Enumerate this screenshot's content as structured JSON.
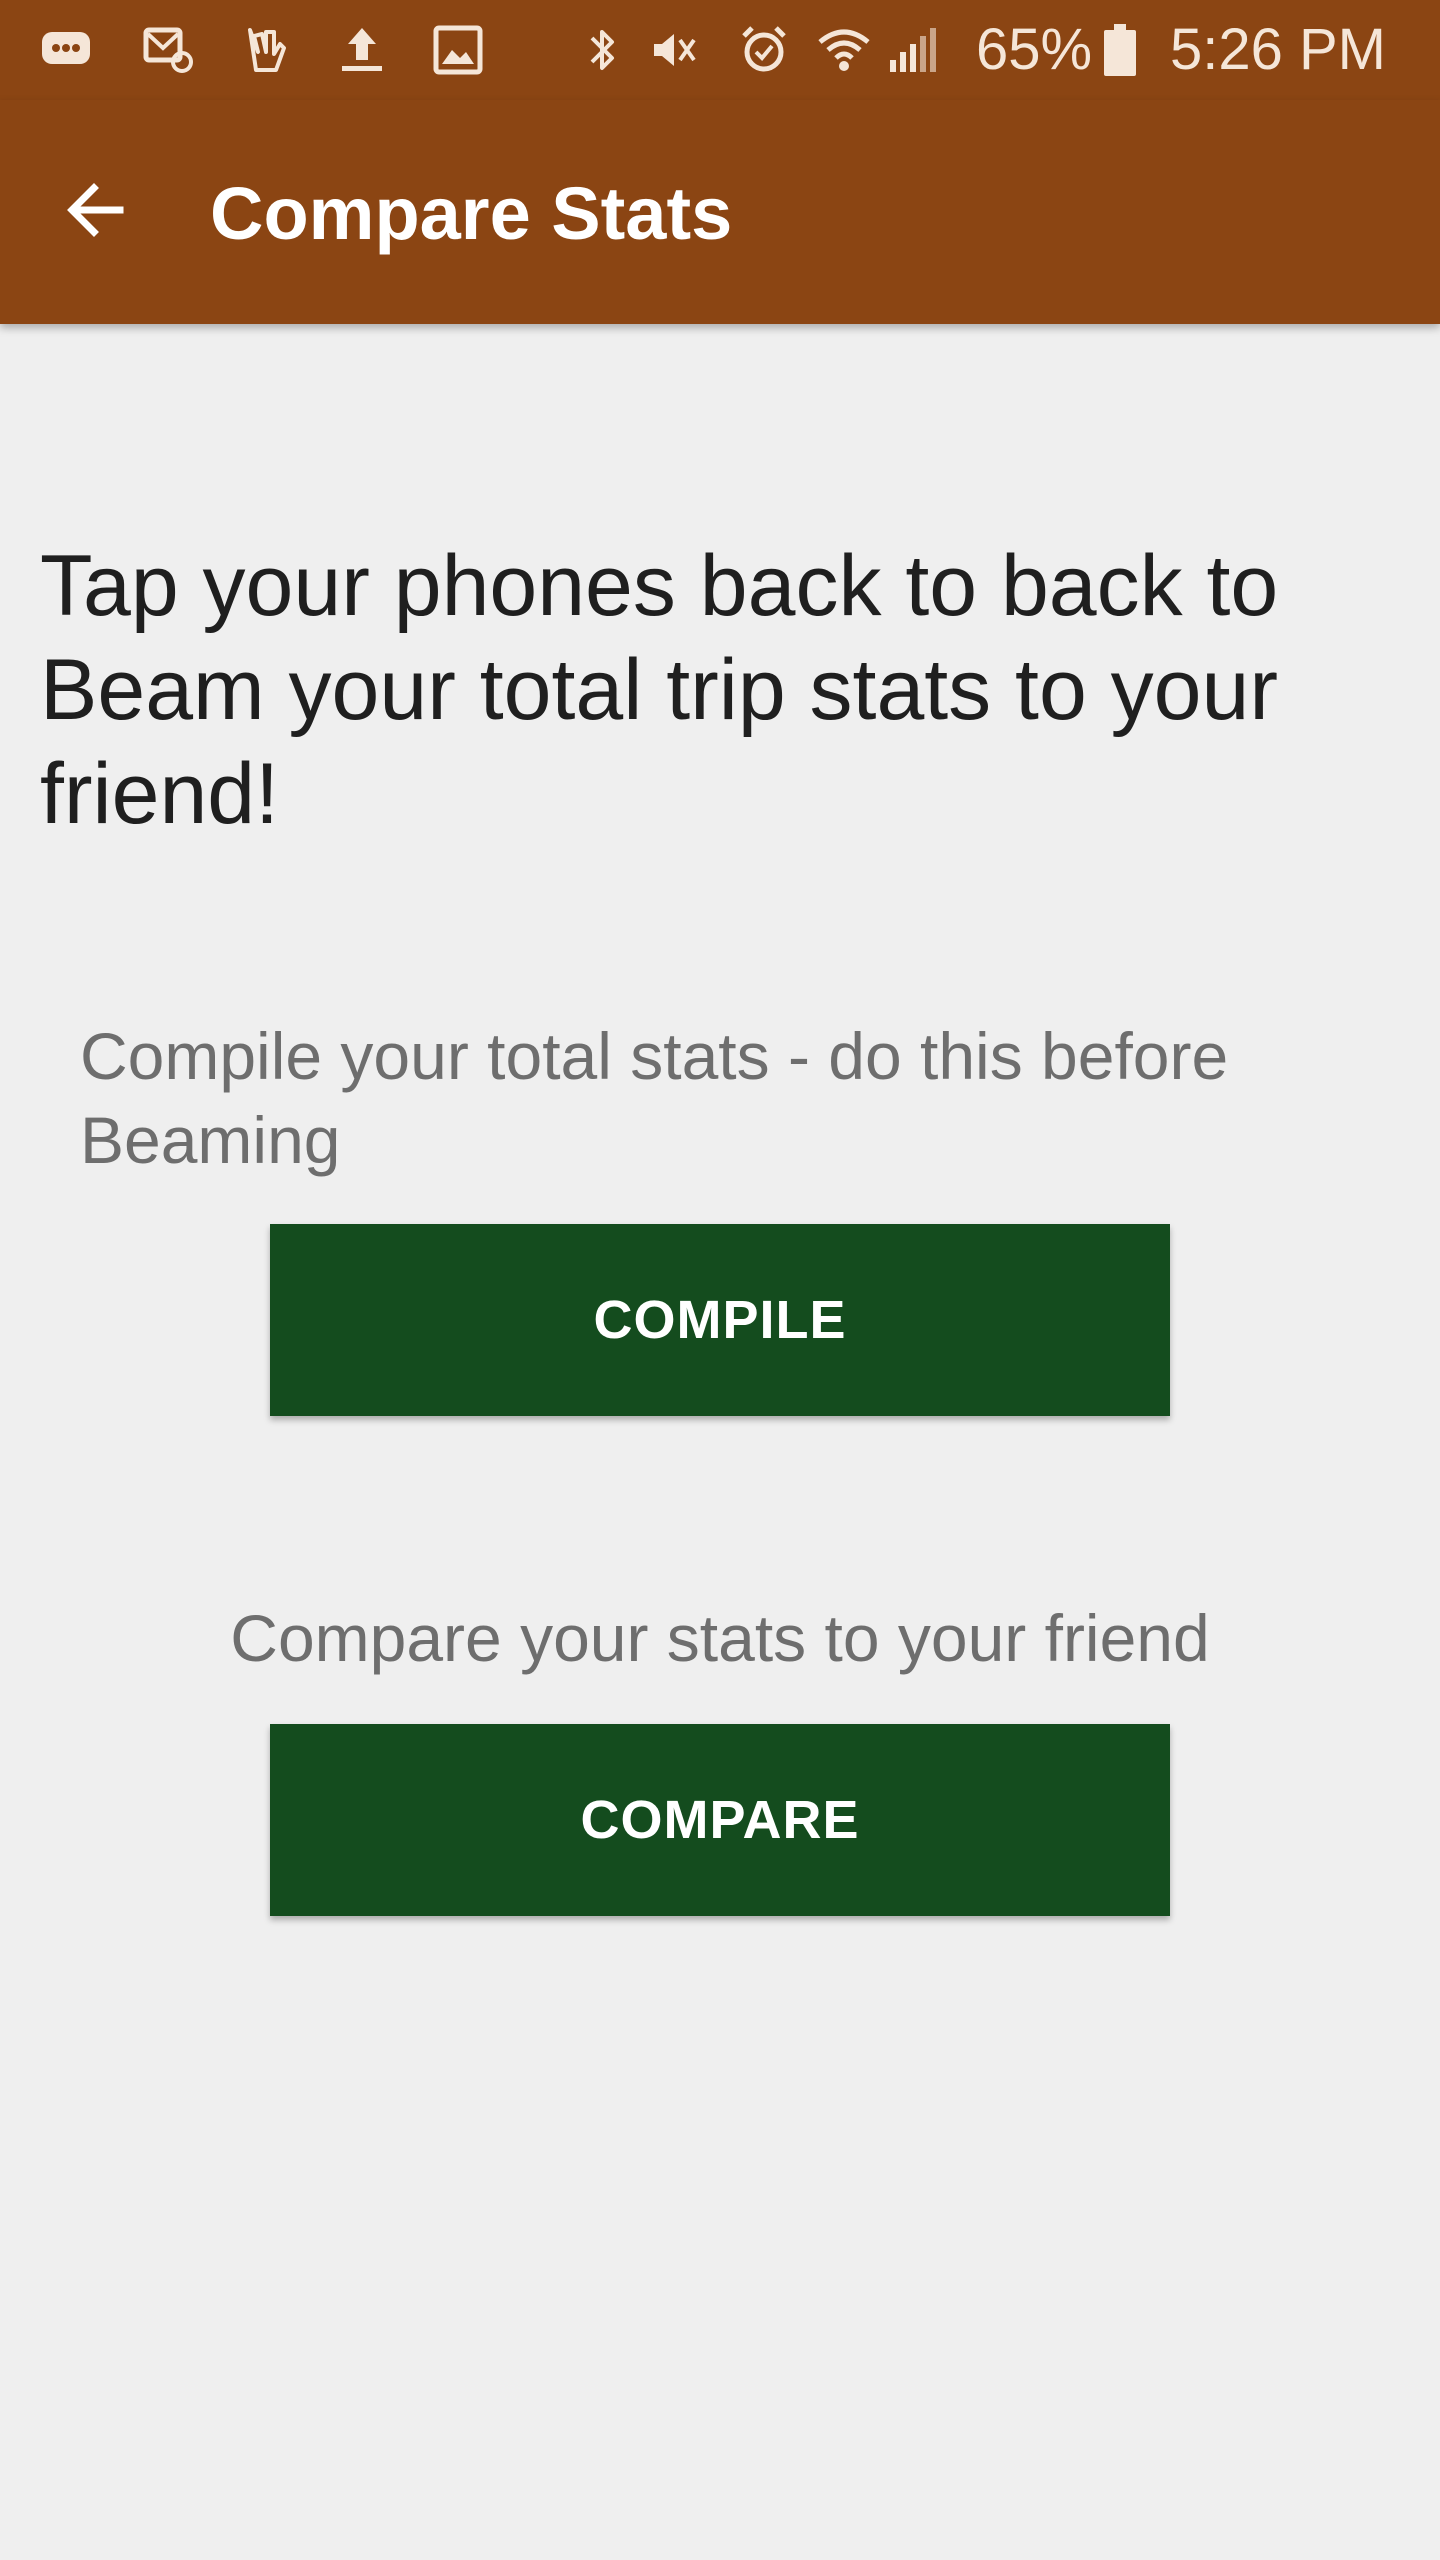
{
  "status_bar": {
    "notification_icons": [
      "chat-bubble-icon",
      "email-icon",
      "hand-icon",
      "upload-icon",
      "image-icon"
    ],
    "system_icons": [
      "bluetooth-icon",
      "mute-icon",
      "alarm-icon",
      "wifi-icon",
      "cell-signal-icon"
    ],
    "battery_percent": "65%",
    "time": "5:26 PM"
  },
  "app_bar": {
    "title": "Compare Stats",
    "back_icon": "arrow-back-icon",
    "color": "#8b4513"
  },
  "main": {
    "headline": "Tap your phones back to back to Beam your total trip stats to your friend!",
    "compile_label": "Compile your total stats - do this before Beaming",
    "compile_button": "COMPILE",
    "compare_label": "Compare your stats to your friend",
    "compare_button": "COMPARE",
    "button_color": "#144c1e"
  }
}
